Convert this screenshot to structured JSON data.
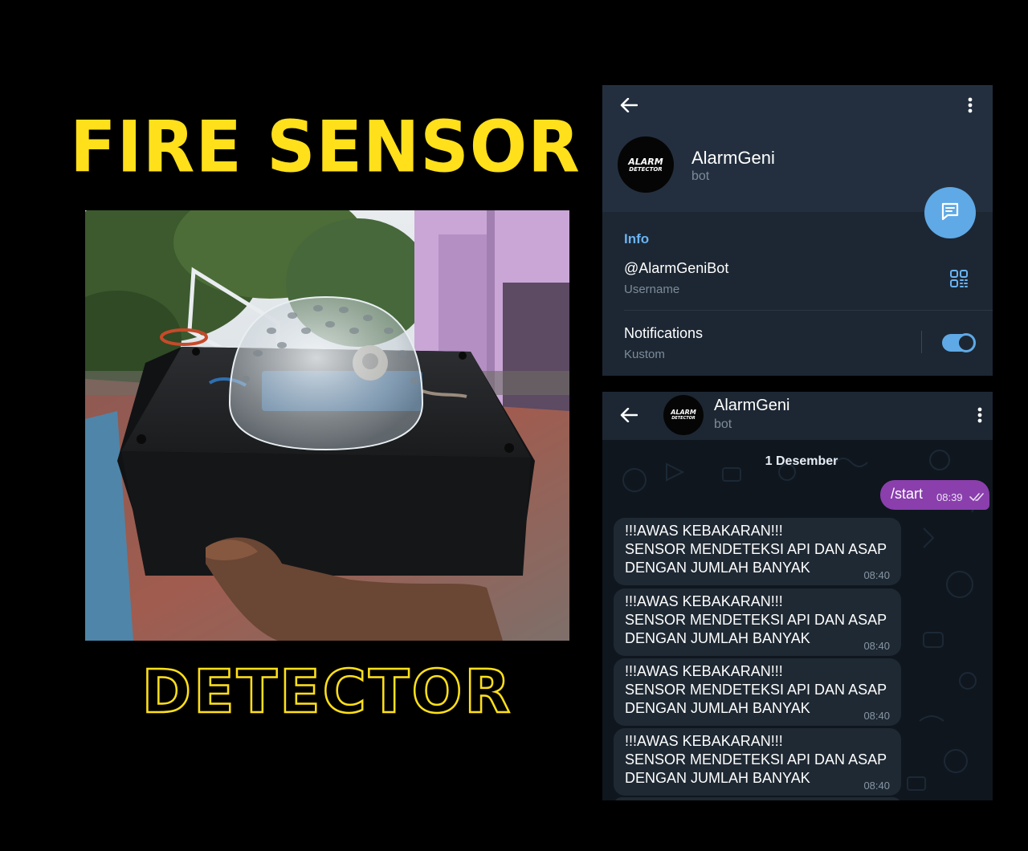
{
  "poster": {
    "headline": "FIRE SENSOR",
    "subheadline": "DETECTOR",
    "accent_color": "#FFE01A"
  },
  "profile": {
    "back_icon": "arrow-left-icon",
    "menu_icon": "more-vertical-icon",
    "avatar_text_line1": "ALARM",
    "avatar_text_line2": "DETECTOR",
    "name": "AlarmGeni",
    "type": "bot",
    "fab_icon": "message-icon",
    "section_label": "Info",
    "username_value": "@AlarmGeniBot",
    "username_caption": "Username",
    "qr_icon": "qr-code-icon",
    "notifications_value": "Notifications",
    "notifications_caption": "Kustom",
    "notifications_enabled": true
  },
  "chat": {
    "back_icon": "arrow-left-icon",
    "menu_icon": "more-vertical-icon",
    "avatar_text_line1": "ALARM",
    "avatar_text_line2": "DETECTOR",
    "name": "AlarmGeni",
    "type": "bot",
    "date_separator": "1 Desember",
    "outgoing": {
      "text": "/start",
      "time": "08:39",
      "status": "read"
    },
    "incoming": [
      {
        "line1": "!!!AWAS KEBAKARAN!!!",
        "line2": "SENSOR MENDETEKSI API DAN ASAP",
        "line3": "DENGAN JUMLAH BANYAK",
        "time": "08:40"
      },
      {
        "line1": "!!!AWAS KEBAKARAN!!!",
        "line2": "SENSOR MENDETEKSI API DAN ASAP",
        "line3": "DENGAN JUMLAH BANYAK",
        "time": "08:40"
      },
      {
        "line1": "!!!AWAS KEBAKARAN!!!",
        "line2": "SENSOR MENDETEKSI API DAN ASAP",
        "line3": "DENGAN JUMLAH BANYAK",
        "time": "08:40"
      },
      {
        "line1": "!!!AWAS KEBAKARAN!!!",
        "line2": "SENSOR MENDETEKSI API DAN ASAP",
        "line3": "DENGAN JUMLAH BANYAK",
        "time": "08:40"
      }
    ]
  }
}
